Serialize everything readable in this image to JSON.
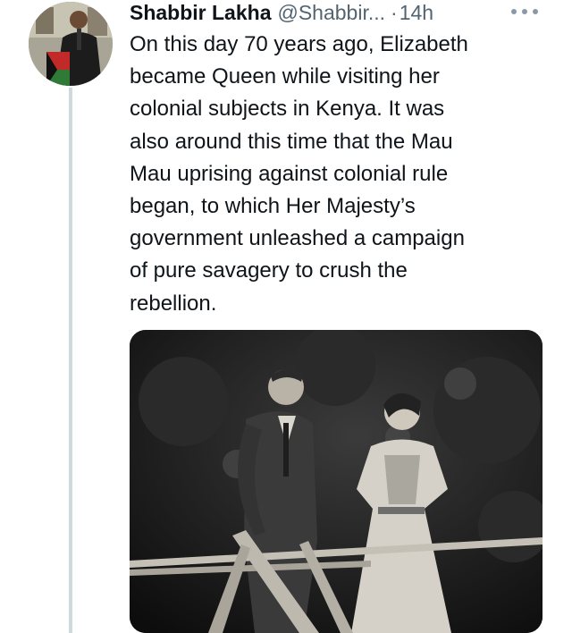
{
  "tweet": {
    "author_name": "Shabbir Lakha",
    "author_handle": "@Shabbir...",
    "separator": "·",
    "timestamp": "14h",
    "text": "On this day 70 years ago, Elizabeth\nbecame Queen while visiting her\ncolonial subjects in Kenya. It was\nalso around this time that the Mau\nMau uprising against colonial rule\nbegan, to which Her Majesty’s\ngovernment unleashed a campaign\nof pure savagery to crush the\nrebellion."
  },
  "icons": {
    "more": "more-options-icon",
    "avatar": "avatar"
  },
  "colors": {
    "text": "#0f1419",
    "secondary": "#536471",
    "thread_line": "#cfd9de"
  }
}
